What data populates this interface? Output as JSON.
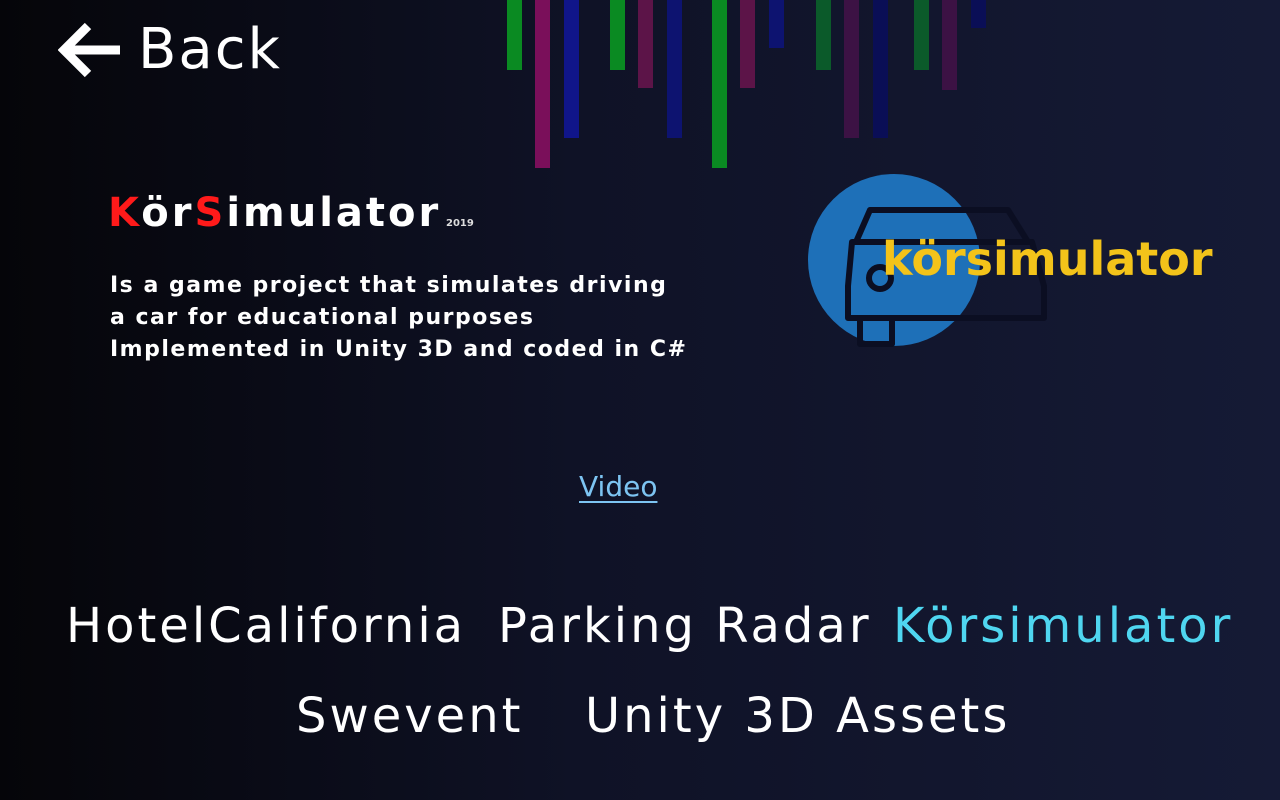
{
  "back": {
    "label": "Back",
    "icon": "arrow-left-icon"
  },
  "project": {
    "title_parts": [
      "K",
      "ör",
      "S",
      "imulator"
    ],
    "year": "2019",
    "description_lines": [
      "Is a game project that simulates driving",
      "a car for educational purposes",
      "Implemented in Unity 3D and coded in C#"
    ],
    "video_link": "Video",
    "logo_text": "körsimulator",
    "logo_icon": "car-icon"
  },
  "nav": [
    {
      "label": "HotelCalifornia",
      "active": false
    },
    {
      "label": "Parking Radar",
      "active": false
    },
    {
      "label": "Körsimulator",
      "active": true
    },
    {
      "label": "Swevent",
      "active": false
    },
    {
      "label": "Unity 3D Assets",
      "active": false
    }
  ],
  "colors": {
    "accent_red": "#ff1a1a",
    "active_nav": "#4fd6f0",
    "link": "#7dc4f2",
    "logo_blue": "#1e70b8",
    "logo_yellow": "#f3c31a",
    "bar_colors": [
      "#0a8a22",
      "#7a0f5a",
      "#10158a",
      "#0a8a22",
      "#5c1448",
      "#0d1370",
      "#0a8a22",
      "#5c1448",
      "#0d1370",
      "#0b5a2a",
      "#3c1244",
      "#0a0e56",
      "#0b5a2a",
      "#3c1244",
      "#0a0e56"
    ]
  }
}
